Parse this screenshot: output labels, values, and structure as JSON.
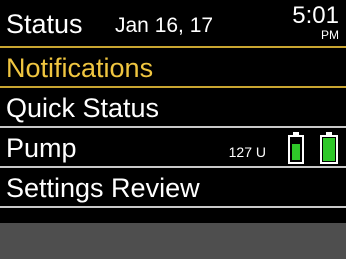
{
  "header": {
    "title": "Status",
    "date": "Jan 16, 17",
    "time": "5:01",
    "ampm": "PM"
  },
  "menu": {
    "items": [
      {
        "label": "Notifications",
        "selected": true
      },
      {
        "label": "Quick Status",
        "selected": false
      },
      {
        "label": "Pump",
        "selected": false
      },
      {
        "label": "Settings Review",
        "selected": false
      }
    ]
  },
  "pump": {
    "units": "127 U",
    "reservoir_icon": "insulin-reservoir-icon",
    "battery_icon": "battery-full-icon",
    "accent_color": "#2fc829"
  },
  "colors": {
    "selected_text": "#f0c640",
    "rule": "#c9a531",
    "footer": "#4e4e4e"
  }
}
